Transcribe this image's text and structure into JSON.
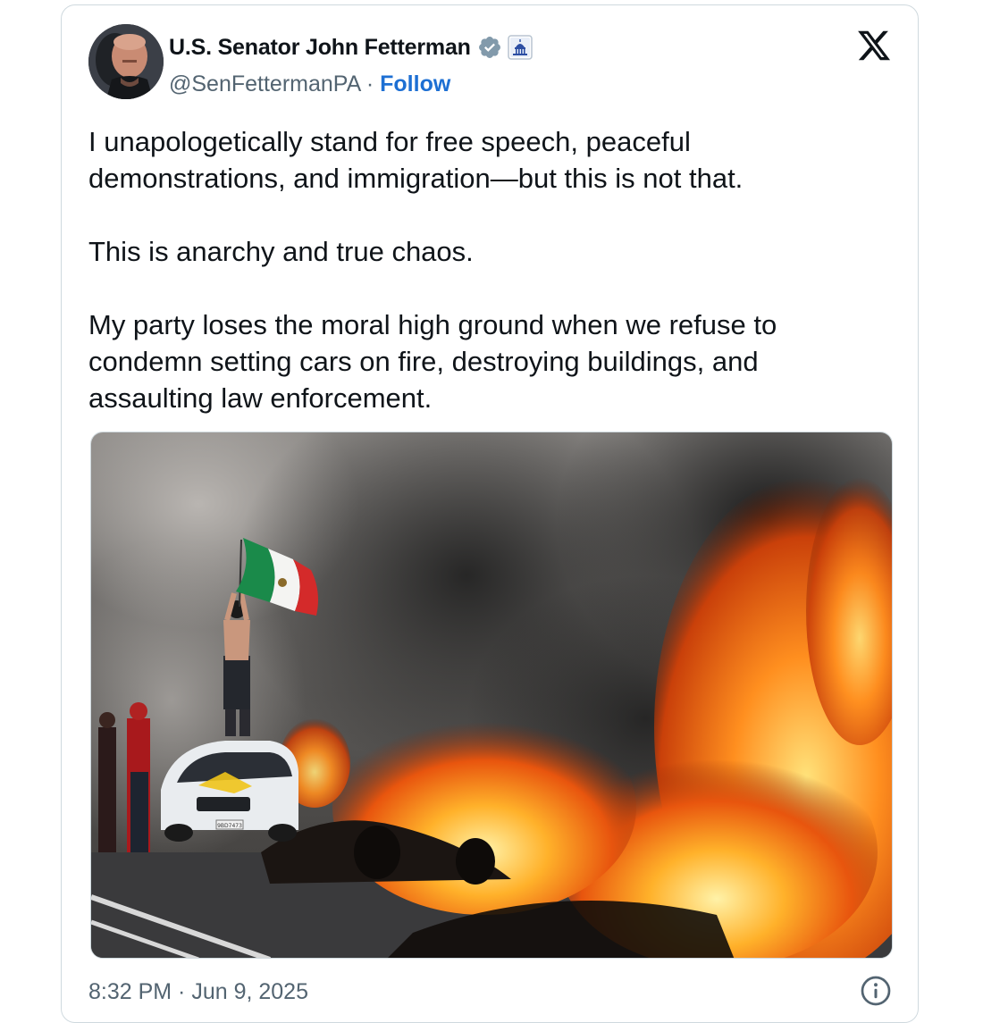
{
  "author": {
    "name": "U.S. Senator John Fetterman",
    "handle": "@SenFettermanPA",
    "separator": "·",
    "follow_label": "Follow",
    "badges": [
      "verified-icon",
      "capitol-affiliation-icon"
    ]
  },
  "platform": {
    "logo": "x-logo-icon"
  },
  "tweet": {
    "paragraphs": [
      "I unapologetically stand for free speech, peaceful demonstrations, and immigration—but this is not that.",
      "This is anarchy and true chaos.",
      "My party loses the moral high ground when we refuse to condemn setting cars on fire, destroying buildings, and assaulting law enforcement."
    ]
  },
  "media": {
    "car_plate": "9BD7473"
  },
  "footer": {
    "timestamp": "8:32 PM · Jun 9, 2025",
    "info_icon": "info-icon"
  },
  "colors": {
    "text": "#0f1419",
    "secondary": "#536471",
    "link": "#1d6fd3",
    "border": "#cfd9de",
    "verified": "#829aab"
  }
}
